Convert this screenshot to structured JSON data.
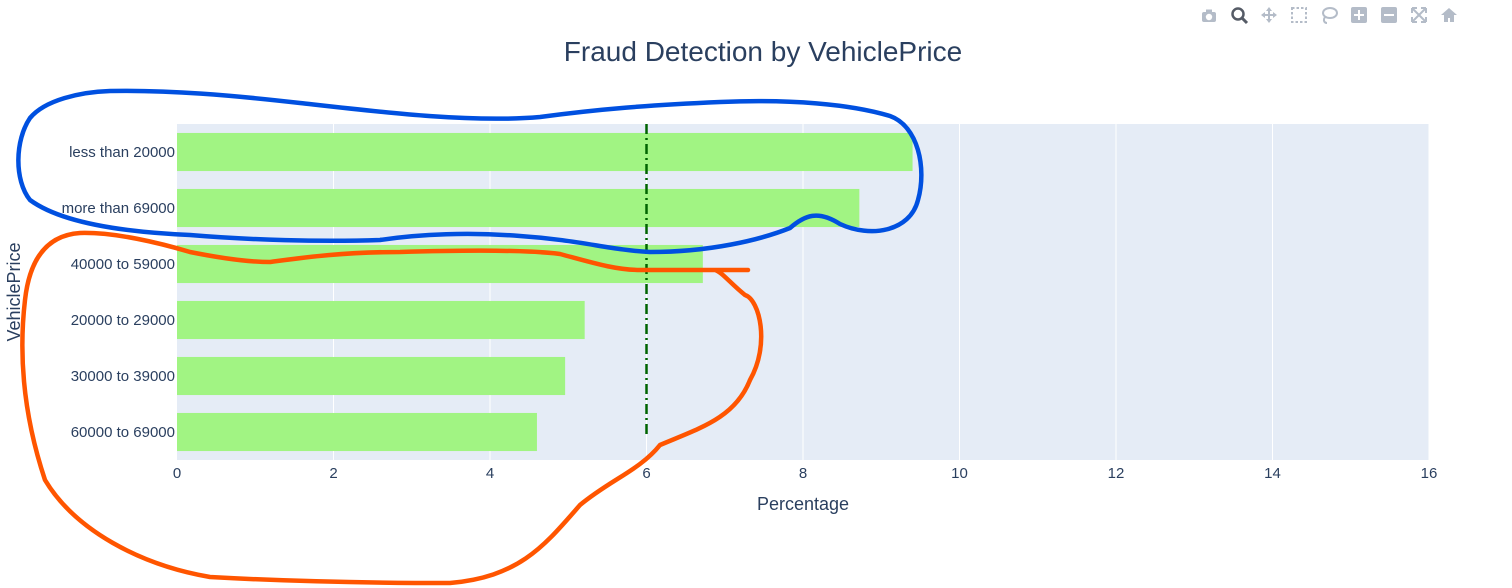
{
  "toolbar": {
    "buttons": [
      {
        "name": "camera-icon",
        "title": "Download plot as a png"
      },
      {
        "name": "zoom-icon",
        "title": "Zoom"
      },
      {
        "name": "pan-icon",
        "title": "Pan"
      },
      {
        "name": "box-select-icon",
        "title": "Box Select"
      },
      {
        "name": "lasso-select-icon",
        "title": "Lasso Select"
      },
      {
        "name": "zoom-in-icon",
        "title": "Zoom in"
      },
      {
        "name": "zoom-out-icon",
        "title": "Zoom out"
      },
      {
        "name": "autoscale-icon",
        "title": "Autoscale"
      },
      {
        "name": "reset-axes-icon",
        "title": "Reset axes"
      }
    ],
    "icon_color": "#b4bcc8",
    "active_icon_color": "#555b66"
  },
  "chart_data": {
    "type": "bar",
    "orientation": "horizontal",
    "title": "Fraud Detection by VehiclePrice",
    "xlabel": "Percentage",
    "ylabel": "VehiclePrice",
    "categories": [
      "less than 20000",
      "more than 69000",
      "40000 to 59000",
      "20000 to 29000",
      "30000 to 39000",
      "60000 to 69000"
    ],
    "values": [
      9.4,
      8.72,
      6.72,
      5.21,
      4.96,
      4.6
    ],
    "xlim": [
      0,
      16
    ],
    "xticks": [
      0,
      2,
      4,
      6,
      8,
      10,
      12,
      14,
      16
    ],
    "reference_line": {
      "x": 6,
      "style": "dashdot",
      "color": "#006400"
    },
    "grid": true,
    "colors": {
      "bar": "#a1f483",
      "plot_bg": "#e5ecf6",
      "grid": "#ffffff",
      "text": "#2a3f5f"
    },
    "annotations": [
      {
        "type": "freehand-loop",
        "color": "#0050e0",
        "around": [
          "less than 20000",
          "more than 69000"
        ]
      },
      {
        "type": "freehand-loop",
        "color": "#ff5500",
        "around": [
          "40000 to 59000",
          "20000 to 29000",
          "30000 to 39000",
          "60000 to 69000"
        ]
      }
    ]
  }
}
